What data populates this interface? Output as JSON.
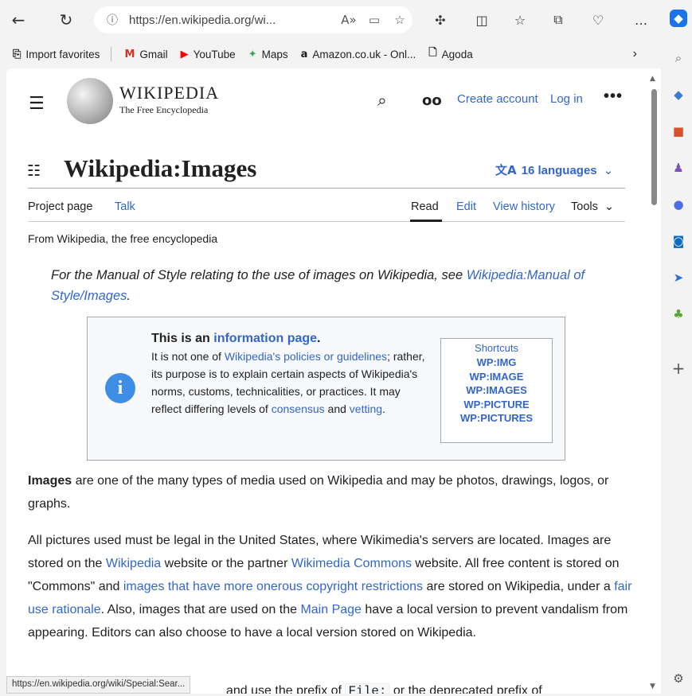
{
  "browser": {
    "url": "https://en.wikipedia.org/wi...",
    "bookmarks": [
      {
        "icon": "import-icon",
        "glyph": "⎘",
        "label": "Import favorites"
      },
      {
        "icon": "gmail-icon",
        "glyph": "M",
        "label": "Gmail",
        "color": "#d93025"
      },
      {
        "icon": "youtube-icon",
        "glyph": "▶",
        "label": "YouTube",
        "color": "#ff0000"
      },
      {
        "icon": "maps-icon",
        "glyph": "✦",
        "label": "Maps",
        "color": "#34a853"
      },
      {
        "icon": "amazon-icon",
        "glyph": "a",
        "label": "Amazon.co.uk - Onl...",
        "color": "#111111"
      },
      {
        "icon": "page-icon",
        "glyph": "🗋",
        "label": "Agoda"
      }
    ],
    "status_url": "https://en.wikipedia.org/wiki/Special:Sear..."
  },
  "header": {
    "wordmark": "WIKIPEDIA",
    "tagline": "The Free Encyclopedia",
    "create_account": "Create account",
    "log_in": "Log in",
    "more": "•••"
  },
  "page": {
    "title": "Wikipedia:Images",
    "languages": "16 languages",
    "tabs_left": [
      "Project page",
      "Talk"
    ],
    "tabs_right": [
      "Read",
      "Edit",
      "View history",
      "Tools"
    ],
    "from": "From Wikipedia, the free encyclopedia",
    "hatnote_pre": "For the Manual of Style relating to the use of images on Wikipedia, see ",
    "hatnote_link": "Wikipedia:Manual of Style/Images",
    "hatnote_post": "."
  },
  "infobox": {
    "head_pre": "This is an ",
    "head_link": "information page",
    "head_post": ".",
    "l1_pre": "It is not one of ",
    "l1_link": "Wikipedia's policies or guidelines",
    "l1_post": "; rather, its purpose is to explain certain aspects of Wikipedia's norms, customs, technicalities, or practices. It may reflect differing levels of ",
    "consensus": "consensus",
    "and": " and ",
    "vetting": "vetting",
    "end": ".",
    "shortcuts_title": "Shortcuts",
    "shortcuts": [
      "WP:IMG",
      "WP:IMAGE",
      "WP:IMAGES",
      "WP:PICTURE",
      "WP:PICTURES"
    ]
  },
  "body": {
    "p1_bold": "Images",
    "p1_rest": " are one of the many types of media used on Wikipedia and may be photos, drawings, logos, or graphs.",
    "p2_a": "All pictures used must be legal in the United States, where Wikimedia's servers are located. Images are stored on the ",
    "p2_link1": "Wikipedia",
    "p2_b": " website or the partner ",
    "p2_link2": "Wikimedia Commons",
    "p2_c": " website. All free content is stored on \"Commons\" and ",
    "p2_link3": "images that have more onerous copyright restrictions",
    "p2_d": " are stored on Wikipedia, under a ",
    "p2_link4": "fair use rationale",
    "p2_e": ". Also, images that are used on the ",
    "p2_link5": "Main Page",
    "p2_f": " have a local version to prevent vandalism from appearing. Editors can also choose to have a local version stored on Wikipedia.",
    "p3_a": "and use the prefix of ",
    "p3_code": "File:",
    "p3_b": " or the deprecated prefix of"
  },
  "colors": {
    "link": "#3366cc",
    "text": "#202122",
    "info_icon": "#3e8ee6"
  }
}
